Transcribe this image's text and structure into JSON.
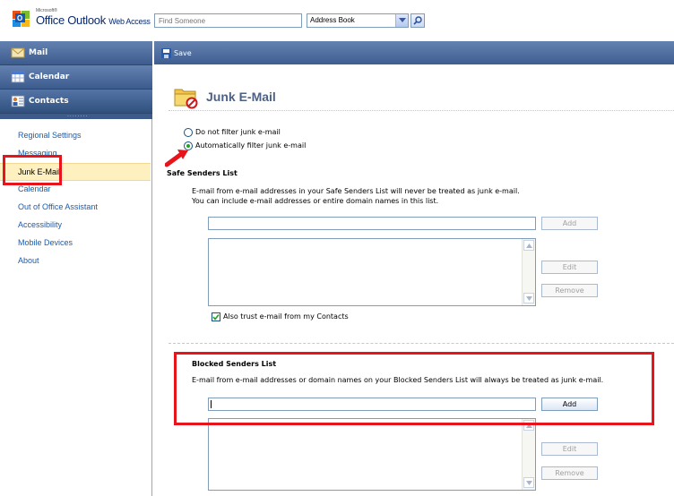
{
  "header": {
    "logo_microsoft": "Microsoft®",
    "logo_product": "Office Outlook",
    "logo_suffix": "Web Access",
    "find_placeholder": "Find Someone",
    "address_book_label": "Address Book"
  },
  "nav": {
    "buttons": [
      {
        "label": "Mail",
        "icon": "mail-icon"
      },
      {
        "label": "Calendar",
        "icon": "calendar-icon"
      },
      {
        "label": "Contacts",
        "icon": "contacts-icon"
      }
    ],
    "grip_dots": "........",
    "items": [
      {
        "label": "Regional Settings"
      },
      {
        "label": "Messaging"
      },
      {
        "label": "Junk E-Mail",
        "selected": true
      },
      {
        "label": "Calendar"
      },
      {
        "label": "Out of Office Assistant"
      },
      {
        "label": "Accessibility"
      },
      {
        "label": "Mobile Devices"
      },
      {
        "label": "About"
      }
    ]
  },
  "toolbar": {
    "save_label": "Save"
  },
  "page": {
    "title": "Junk E-Mail",
    "radio_off_label": "Do not filter junk e-mail",
    "radio_on_label": "Automatically filter junk e-mail",
    "selected_option": "Automatically filter junk e-mail"
  },
  "safe": {
    "title": "Safe Senders List",
    "desc_line1": "E-mail from e-mail addresses in your Safe Senders List will never be treated as junk e-mail.",
    "desc_line2": "You can include e-mail addresses or entire domain names in this list.",
    "input_value": "",
    "add_label": "Add",
    "edit_label": "Edit",
    "remove_label": "Remove",
    "trust_label": "Also trust e-mail from my Contacts",
    "trust_checked": true
  },
  "blocked": {
    "title": "Blocked Senders List",
    "desc": "E-mail from e-mail addresses or domain names on your Blocked Senders List will always be treated as junk e-mail.",
    "input_value": "",
    "add_label": "Add",
    "edit_label": "Edit",
    "remove_label": "Remove"
  },
  "colors": {
    "nav_blue": "#3d5c8e",
    "link_blue": "#1a5cb0",
    "selected_bg": "#fff0c0",
    "highlight_red": "#e8141c",
    "title_blue": "#4d6185"
  }
}
